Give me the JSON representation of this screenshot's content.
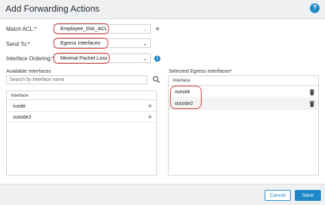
{
  "dialog": {
    "title": "Add Forwarding Actions",
    "help_icon": "?"
  },
  "form": {
    "match_acl": {
      "label": "Match ACL:*",
      "value": "Employee_DIA_ACL"
    },
    "send_to": {
      "label": "Send To:*",
      "value": "Egress Interfaces"
    },
    "interface_ordering": {
      "label": "Interface Ordering:*",
      "value": "Minimal Packet Loss",
      "info_icon": "i"
    }
  },
  "available": {
    "title": "Available Interfaces",
    "search_placeholder": "Search by interface name",
    "column_header": "Interface",
    "items": [
      {
        "name": "inside"
      },
      {
        "name": "outside3"
      }
    ]
  },
  "selected": {
    "title": "Selected Egress Interfaces*",
    "column_header": "Interface",
    "items": [
      {
        "name": "outside"
      },
      {
        "name": "outside2"
      }
    ]
  },
  "footer": {
    "cancel_label": "Cancel",
    "save_label": "Save"
  },
  "colors": {
    "accent": "#1e88c8",
    "highlight_ring": "#d9352f"
  }
}
